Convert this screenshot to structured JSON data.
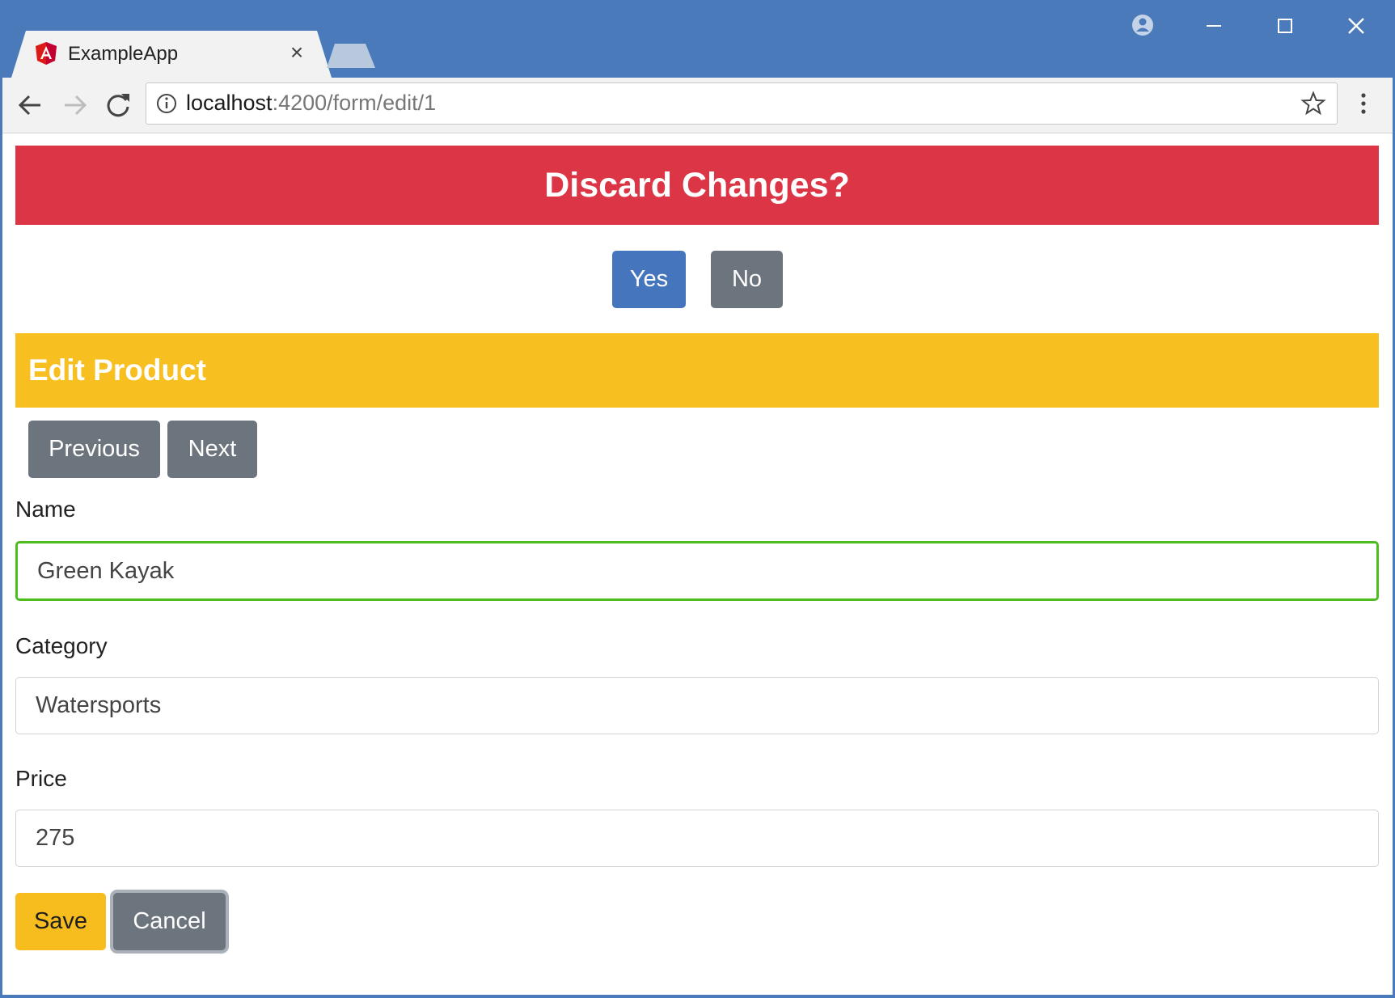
{
  "browser": {
    "tab": {
      "title": "ExampleApp"
    },
    "url": {
      "host": "localhost",
      "path": ":4200/form/edit/1"
    }
  },
  "dialog": {
    "title": "Discard Changes?",
    "yes_label": "Yes",
    "no_label": "No"
  },
  "form": {
    "heading": "Edit Product",
    "previous_label": "Previous",
    "next_label": "Next",
    "name_label": "Name",
    "name_value": "Green Kayak",
    "category_label": "Category",
    "category_value": "Watersports",
    "price_label": "Price",
    "price_value": "275",
    "save_label": "Save",
    "cancel_label": "Cancel"
  },
  "colors": {
    "titlebar": "#4a7aba",
    "danger": "#dc3545",
    "warning": "#f7bf20",
    "primary": "#4576bd",
    "secondary": "#6c757d",
    "valid_border": "#4cbc1e"
  },
  "icons": [
    "angular-logo-icon",
    "close-icon",
    "account-icon",
    "minimize-icon",
    "maximize-icon",
    "window-close-icon",
    "back-icon",
    "forward-icon",
    "reload-icon",
    "info-icon",
    "star-icon",
    "more-menu-icon"
  ]
}
